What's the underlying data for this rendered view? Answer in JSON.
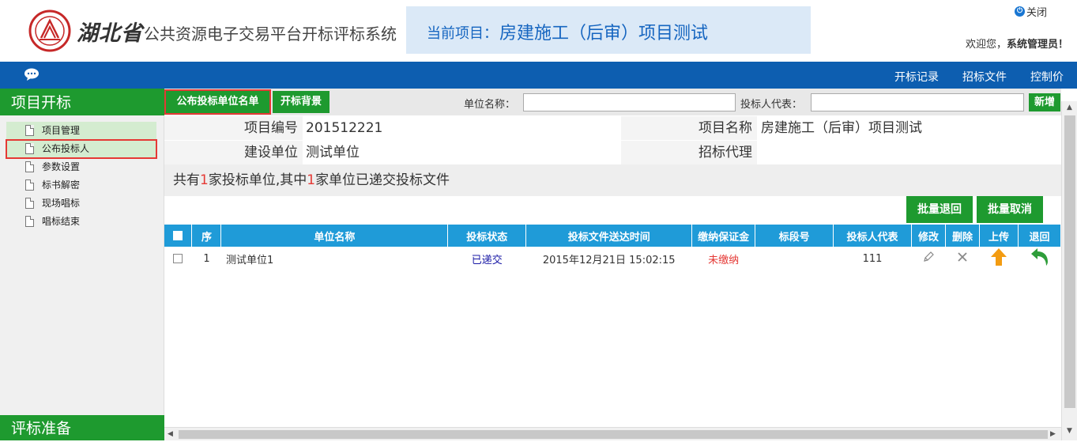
{
  "header": {
    "province": "湖北省",
    "system_title": "公共资源电子交易平台开标评标系统",
    "current_project_label": "当前项目：",
    "current_project_value": "房建施工（后审）项目测试",
    "close_label": "关闭",
    "welcome_prefix": "欢迎您，",
    "welcome_user": "系统管理员！"
  },
  "topnav": {
    "items": [
      "开标记录",
      "招标文件",
      "控制价"
    ]
  },
  "sidebar": {
    "title": "项目开标",
    "items": [
      {
        "label": "项目管理"
      },
      {
        "label": "公布投标人"
      },
      {
        "label": "参数设置"
      },
      {
        "label": "标书解密"
      },
      {
        "label": "现场唱标"
      },
      {
        "label": "唱标结束"
      }
    ],
    "footer": "评标准备"
  },
  "tabs": {
    "tab1": "公布投标单位名单",
    "tab2": "开标背景"
  },
  "filters": {
    "unit_name_label": "单位名称：",
    "unit_name_value": "",
    "representative_label": "投标人代表：",
    "representative_value": "",
    "add_button": "新增"
  },
  "project_info": {
    "code_label": "项目编号",
    "code_value": "201512221",
    "name_label": "项目名称",
    "name_value": "房建施工（后审）项目测试",
    "builder_label": "建设单位",
    "builder_value": "测试单位",
    "agent_label": "招标代理",
    "agent_value": ""
  },
  "summary": {
    "p1": "共有",
    "total": "1",
    "p2": "家投标单位,其中",
    "submitted": "1",
    "p3": "家单位已递交投标文件"
  },
  "batch": {
    "return_label": "批量退回",
    "cancel_label": "批量取消"
  },
  "table": {
    "headers": [
      "序",
      "单位名称",
      "投标状态",
      "投标文件送达时间",
      "缴纳保证金",
      "标段号",
      "投标人代表",
      "修改",
      "删除",
      "上传",
      "退回"
    ],
    "rows": [
      {
        "seq": "1",
        "unit": "测试单位1",
        "status": "已递交",
        "time": "2015年12月21日 15:02:15",
        "deposit": "未缴纳",
        "section": "",
        "rep": "111"
      }
    ]
  },
  "colors": {
    "green": "#1e9a2f",
    "nav_blue": "#0d5eb0",
    "header_blue": "#1f9bd8",
    "red": "#e53935"
  }
}
